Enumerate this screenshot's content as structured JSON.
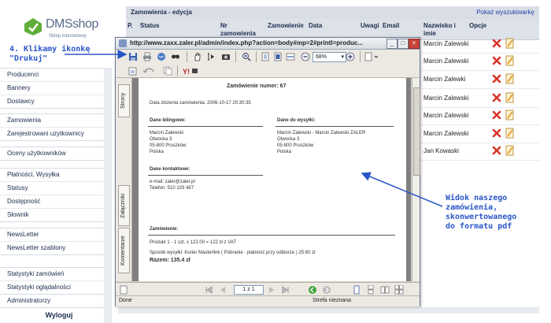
{
  "logo": {
    "brand": "DMSshop",
    "tagline": "Sklep Internetowy"
  },
  "sidebar": {
    "groups": [
      [
        "Producenci",
        "Bannery",
        "Dostawcy"
      ],
      [
        "Zamowienia",
        "Zarejestrowani uzytkownicy"
      ],
      [
        "Oceny użytkowników"
      ],
      [
        "Płatności, Wysyłka",
        "Statusy",
        "Dostępność",
        "Słownik"
      ],
      [
        "NewsLetter",
        "NewsLetter szablony"
      ],
      [
        "Statystyki zamówień",
        "Statystyki oglądalności"
      ],
      [
        "Administratorzy"
      ]
    ],
    "logout": "Wyloguj"
  },
  "main": {
    "title": "Zamowienia - edycja",
    "search_link": "Pokaż wyszukiwarkę",
    "columns": [
      "P.",
      "Status",
      "Nr zamowienia",
      "Zamowienie",
      "Data",
      "Uwagi",
      "Email",
      "Nazwisko i imie",
      "Opcje"
    ],
    "rows": [
      "Marcin Zalewski",
      "Marcin Zalewski",
      "Marcin Zalewki",
      "Marcin Zalewski",
      "Marcin Zalewski",
      "Marcin Zalewski",
      "Jan Kowaski"
    ]
  },
  "annotations": {
    "step": "4. Klikamy ikonkę",
    "step2": "\"Drukuj\"",
    "view": [
      "Widok naszego",
      "zamówienia,",
      "skonwertowanego",
      "do formatu pdf"
    ]
  },
  "popup": {
    "url": "http://www.zaxx.zaler.pl/admin/index.php?action=body#mp=2#printl=produc...",
    "zoom": "68%",
    "side_tabs": [
      "Strony",
      "Załączniki",
      "Komentarze"
    ],
    "page_indicator": "1 z 1",
    "status_left": "Done",
    "status_zone": "Strefa nieznana",
    "doc": {
      "heading": "Zamówienie numer: 67",
      "date": "Data złożenia zamówienia: 2006-10-17 20:30:35",
      "billing_title": "Dane bilingowe:",
      "billing": [
        "Marcin Zalewski",
        "Otwocka 3",
        "05-800 Pruszków",
        "Polska"
      ],
      "shipping_title": "Dane do wysyłki:",
      "shipping": [
        "Marcin Zalewski - Marcin Zalewski ZALER",
        "Otwocka 3",
        "05-800 Pruszków",
        "Polska"
      ],
      "contact_title": "Dane kontaktowe:",
      "contact": [
        "e-mail: zaler@zaler.pl",
        "Telefon: 510 103 487"
      ],
      "order_title": "Zamówienie:",
      "product": "Produkt 1 - 1 szt. x 122.00 = 122 zł z VAT",
      "shipping_method": "Sposób wysyłki: Kurier Masterlink ( Pobranie - płatność przy odbiorze ) 25.60 zł",
      "total": "Razem: 135.4 zł"
    }
  },
  "colors": {
    "annotation": "#2a56c8",
    "delete": "#d9342b",
    "edit": "#e8a33a"
  }
}
